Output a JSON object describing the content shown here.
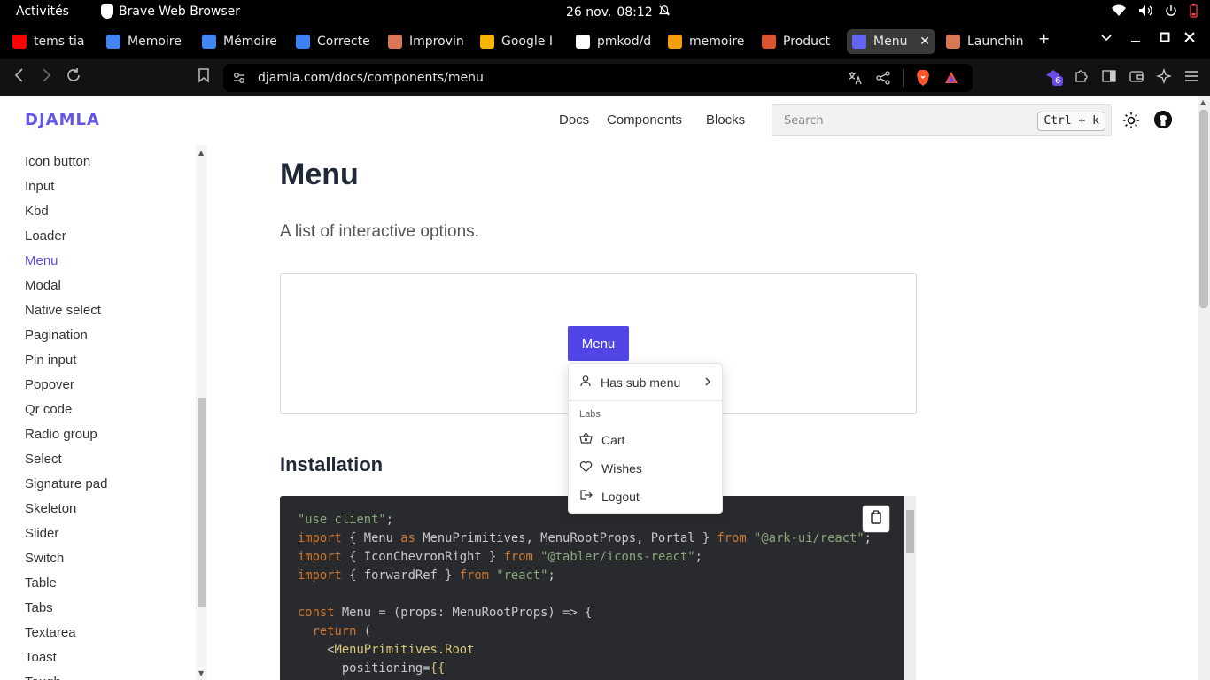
{
  "os": {
    "activities": "Activités",
    "app": "Brave Web Browser",
    "date": "26 nov.",
    "time": "08:12"
  },
  "tabs": [
    {
      "title": "tems tia",
      "color": "#ff0000"
    },
    {
      "title": "Memoire",
      "color": "#4285f4"
    },
    {
      "title": "Mémoire",
      "color": "#4285f4"
    },
    {
      "title": "Correcte",
      "color": "#3b82f6"
    },
    {
      "title": "Improvin",
      "color": "#d97757"
    },
    {
      "title": "Google I",
      "color": "#f4b400"
    },
    {
      "title": "pmkod/d",
      "color": "#ffffff"
    },
    {
      "title": "memoire",
      "color": "#f59e0b"
    },
    {
      "title": "Product",
      "color": "#da552f"
    },
    {
      "title": "Menu",
      "color": "#6366f1",
      "active": true
    },
    {
      "title": "Launchin",
      "color": "#d97757"
    }
  ],
  "address": {
    "url": "djamla.com/docs/components/menu",
    "ext_badge": "6"
  },
  "site": {
    "logo": "DJAMLA",
    "nav": [
      "Docs",
      "Components",
      "Blocks"
    ],
    "search_placeholder": "Search",
    "search_kbd": "Ctrl + k"
  },
  "sidebar": {
    "items": [
      "Icon button",
      "Input",
      "Kbd",
      "Loader",
      "Menu",
      "Modal",
      "Native select",
      "Pagination",
      "Pin input",
      "Popover",
      "Qr code",
      "Radio group",
      "Select",
      "Signature pad",
      "Skeleton",
      "Slider",
      "Switch",
      "Table",
      "Tabs",
      "Textarea",
      "Toast",
      "Tough"
    ],
    "active": "Menu"
  },
  "main": {
    "title": "Menu",
    "description": "A list of interactive options.",
    "demo_button": "Menu",
    "menu": {
      "submenu_label": "Has sub menu",
      "group_label": "Labs",
      "items": [
        "Cart",
        "Wishes",
        "Logout"
      ]
    },
    "installation_heading": "Installation"
  },
  "accent_color": "#4f46e5"
}
